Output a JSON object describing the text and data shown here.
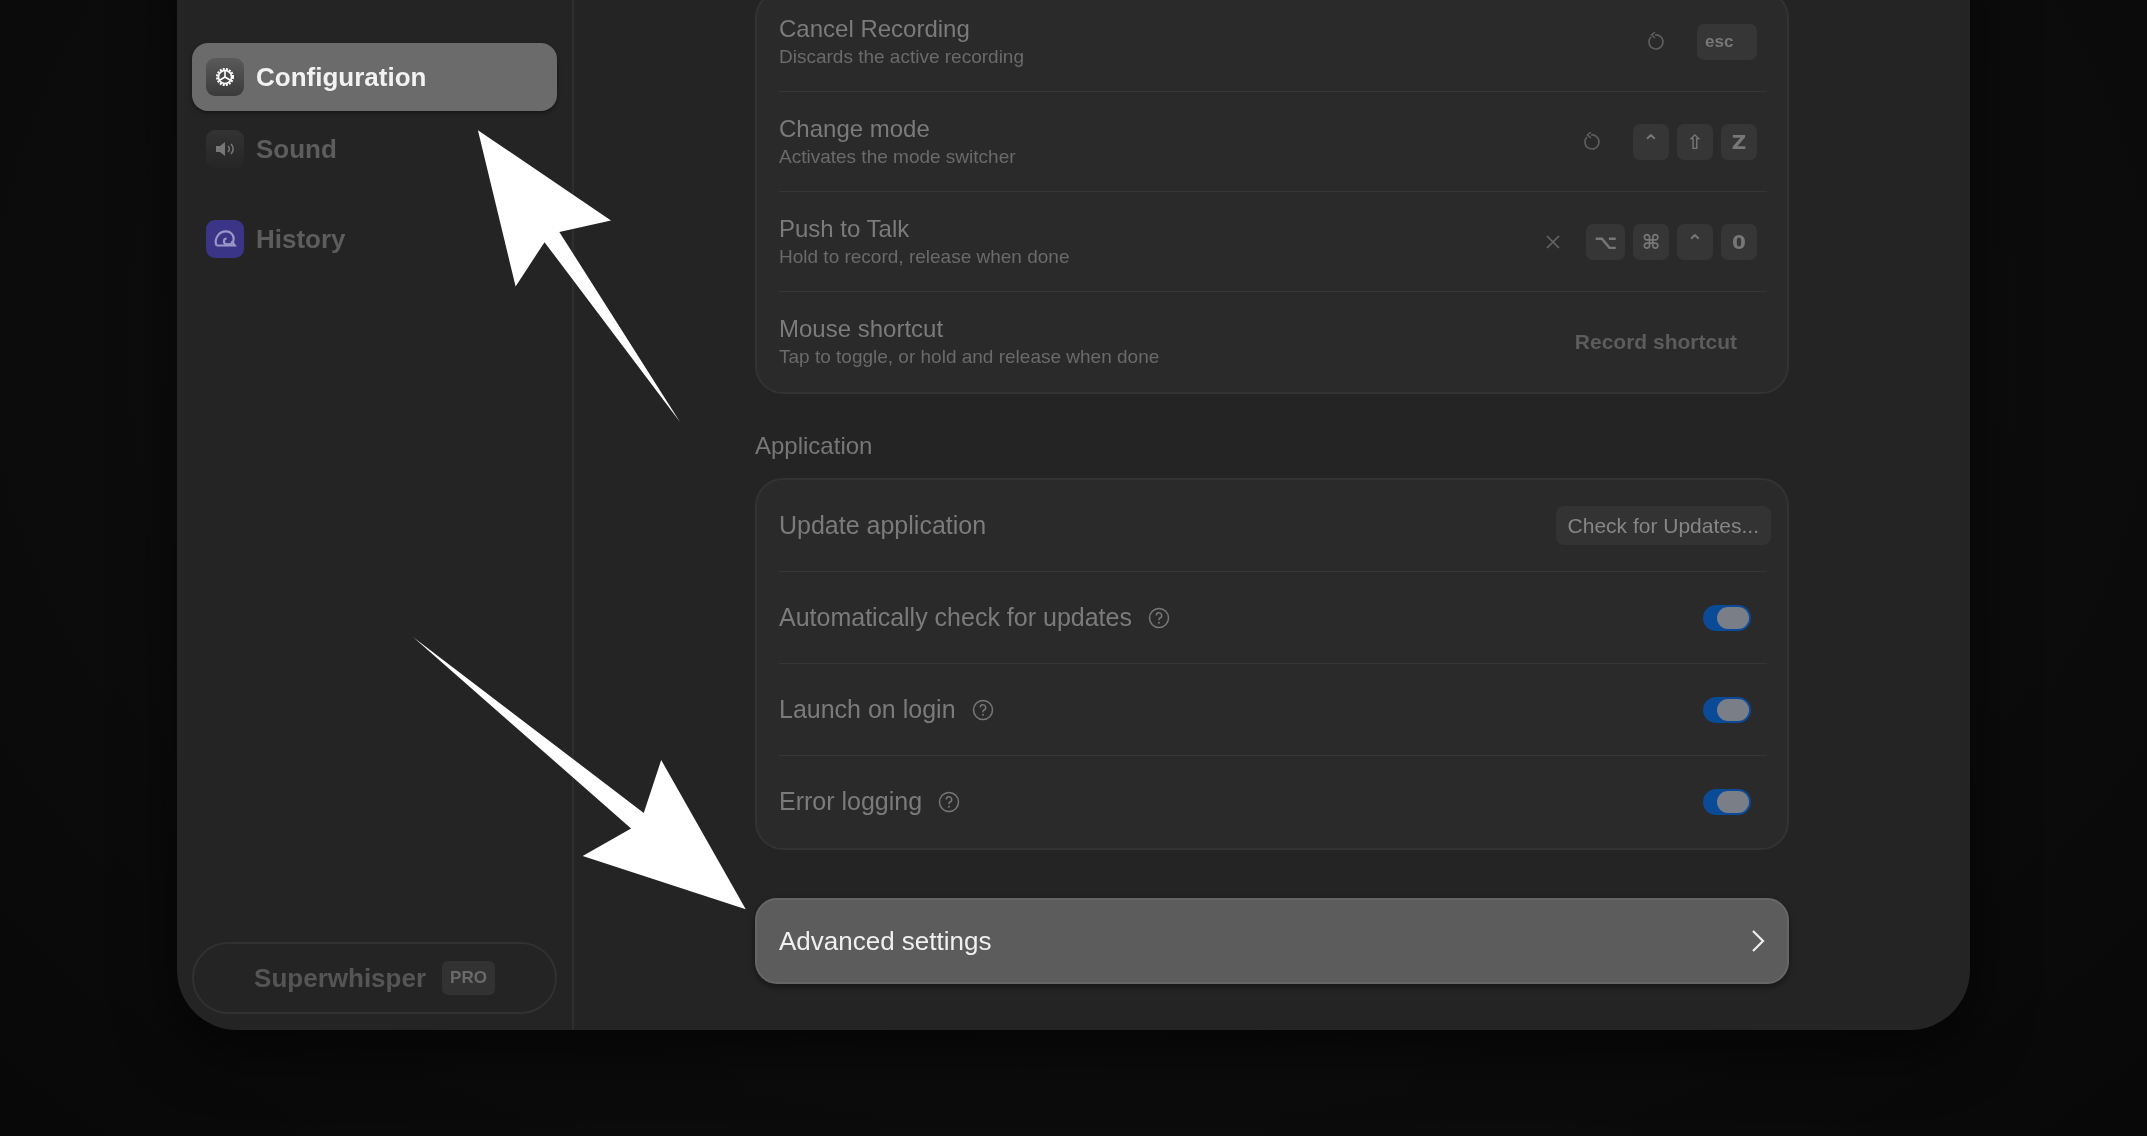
{
  "sidebar": {
    "items": [
      {
        "label": "Configuration",
        "selected": true
      },
      {
        "label": "Sound",
        "selected": false
      },
      {
        "label": "History",
        "selected": false
      }
    ],
    "footer": {
      "brand": "Superwhisper",
      "badge": "PRO"
    }
  },
  "shortcuts": [
    {
      "title": "Cancel Recording",
      "description": "Discards the active recording",
      "kind": "reset_keys",
      "keys": [
        "esc"
      ]
    },
    {
      "title": "Change mode",
      "description": "Activates the mode switcher",
      "kind": "reset_keys",
      "keys": [
        "⌃",
        "⇧",
        "Z"
      ]
    },
    {
      "title": "Push to Talk",
      "description": "Hold to record, release when done",
      "kind": "clear_keys",
      "keys": [
        "⌥",
        "⌘",
        "⌃",
        "0"
      ]
    },
    {
      "title": "Mouse shortcut",
      "description": "Tap to toggle, or hold and release when done",
      "kind": "record",
      "button": "Record shortcut"
    }
  ],
  "application": {
    "title": "Application",
    "rows": [
      {
        "kind": "button",
        "label": "Update application",
        "button": "Check for Updates...",
        "help": false
      },
      {
        "kind": "toggle",
        "label": "Automatically check for updates",
        "help": true,
        "on": true
      },
      {
        "kind": "toggle",
        "label": "Launch on login",
        "help": true,
        "on": true
      },
      {
        "kind": "toggle",
        "label": "Error logging",
        "help": true,
        "on": true
      }
    ]
  },
  "advanced": {
    "label": "Advanced settings"
  }
}
